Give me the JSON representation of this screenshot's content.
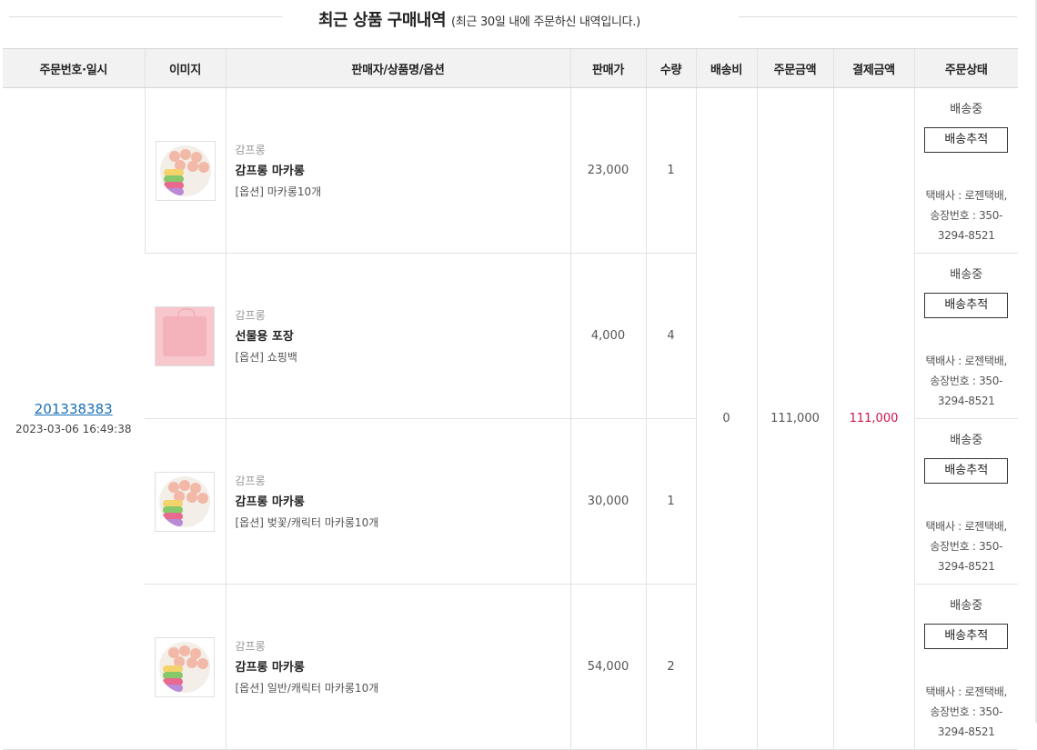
{
  "title": {
    "main": "최근 상품 구매내역",
    "sub": "(최근 30일 내에 주문하신 내역입니다.)"
  },
  "headers": [
    "주문번호·일시",
    "이미지",
    "판매자/상품명/옵션",
    "판매가",
    "수량",
    "배송비",
    "주문금액",
    "결제금액",
    "주문상태"
  ],
  "order": {
    "number": "201338383",
    "datetime": "2023-03-06 16:49:38",
    "shipping_fee": "0",
    "order_amount": "111,000",
    "payment_amount": "111,000"
  },
  "items": [
    {
      "image": "macaron-icon",
      "seller": "감프롱",
      "name": "감프롱 마카롱",
      "option": "[옵션] 마카롱10개",
      "price": "23,000",
      "qty": "1",
      "status": "배송중",
      "track_label": "배송추적",
      "carrier": "택배사 : 로젠택배,",
      "tracking_label": "송장번호 : 350-",
      "tracking_rest": "3294-8521"
    },
    {
      "image": "gift-bag-icon",
      "seller": "감프롱",
      "name": "선물용 포장",
      "option": "[옵션] 쇼핑백",
      "price": "4,000",
      "qty": "4",
      "status": "배송중",
      "track_label": "배송추적",
      "carrier": "택배사 : 로젠택배,",
      "tracking_label": "송장번호 : 350-",
      "tracking_rest": "3294-8521"
    },
    {
      "image": "macaron-icon",
      "seller": "감프롱",
      "name": "감프롱 마카롱",
      "option": "[옵션] 벚꽃/캐릭터 마카롱10개",
      "price": "30,000",
      "qty": "1",
      "status": "배송중",
      "track_label": "배송추적",
      "carrier": "택배사 : 로젠택배,",
      "tracking_label": "송장번호 : 350-",
      "tracking_rest": "3294-8521"
    },
    {
      "image": "macaron-icon",
      "seller": "감프롱",
      "name": "감프롱 마카롱",
      "option": "[옵션] 일반/캐릭터 마카롱10개",
      "price": "54,000",
      "qty": "2",
      "status": "배송중",
      "track_label": "배송추적",
      "carrier": "택배사 : 로젠택배,",
      "tracking_label": "송장번호 : 350-",
      "tracking_rest": "3294-8521"
    }
  ],
  "colors": {
    "link": "#1a6fb5",
    "payment": "#d0114a",
    "header_bg": "#f2f2f2"
  }
}
